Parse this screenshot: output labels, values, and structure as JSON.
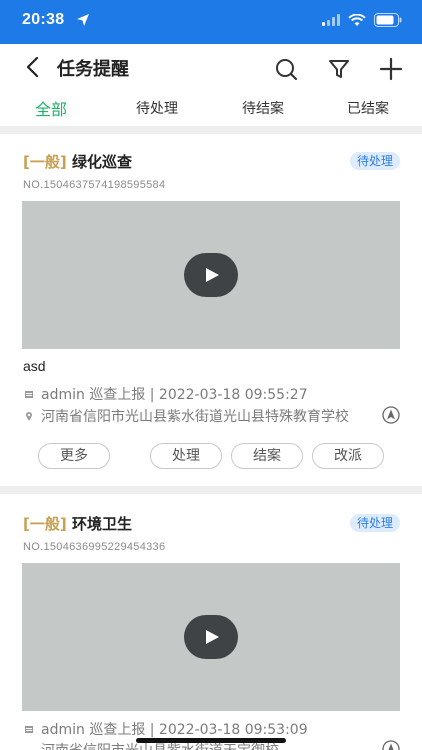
{
  "status": {
    "time": "20:38",
    "accent": "#1d7ae6"
  },
  "nav": {
    "title": "任务提醒"
  },
  "tabs": [
    {
      "label": "全部",
      "active": true
    },
    {
      "label": "待处理",
      "active": false
    },
    {
      "label": "待结案",
      "active": false
    },
    {
      "label": "已结案",
      "active": false
    }
  ],
  "tasks": [
    {
      "level": "[一般]",
      "name": "绿化巡查",
      "status": "待处理",
      "number": "NO.1504637574198595584",
      "description": "asd",
      "meta": "admin 巡查上报 | 2022-03-18 09:55:27",
      "address": "河南省信阳市光山县紫水街道光山县特殊教育学校",
      "actions": [
        "更多",
        "处理",
        "结案",
        "改派"
      ]
    },
    {
      "level": "[一般]",
      "name": "环境卫生",
      "status": "待处理",
      "number": "NO.1504636995229454336",
      "meta": "admin 巡查上报 | 2022-03-18 09:53:09",
      "address": "河南省信阳市光山县紫水街道天宝御校"
    }
  ],
  "colors": {
    "tab_active": "#21b36a",
    "badge_bg": "#dcebfd",
    "badge_text": "#2f7de1",
    "level": "#c7a052"
  }
}
